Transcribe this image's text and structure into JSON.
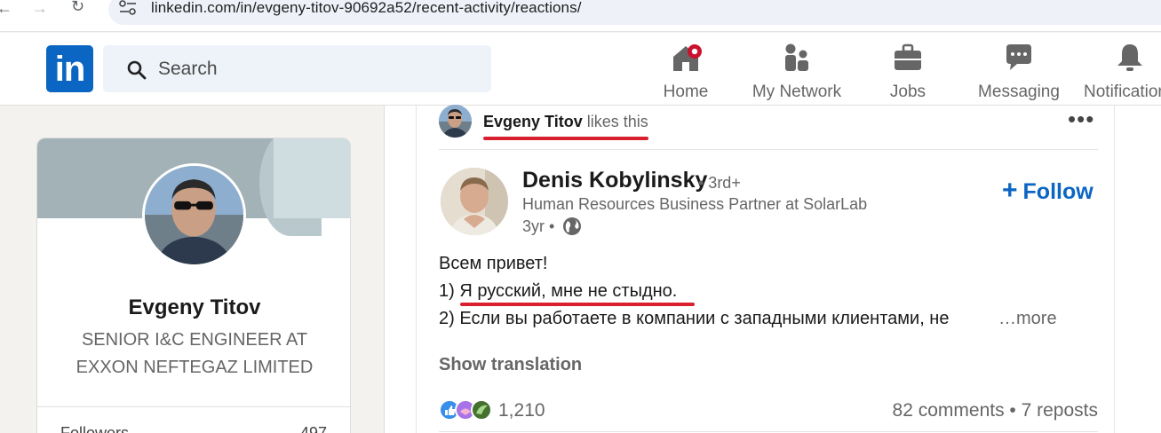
{
  "browser": {
    "url": "linkedin.com/in/evgeny-titov-90692a52/recent-activity/reactions/"
  },
  "header": {
    "logo_text": "in",
    "search": {
      "placeholder": "Search"
    },
    "nav": [
      {
        "label": "Home",
        "icon": "home-icon"
      },
      {
        "label": "My Network",
        "icon": "network-icon"
      },
      {
        "label": "Jobs",
        "icon": "briefcase-icon"
      },
      {
        "label": "Messaging",
        "icon": "message-icon"
      },
      {
        "label": "Notifications",
        "icon": "bell-icon"
      }
    ],
    "accent_color": "#0a66c2",
    "notification_dot_color": "#cb112d"
  },
  "profile": {
    "name": "Evgeny Titov",
    "headline": "SENIOR I&C ENGINEER AT EXXON NEFTEGAZ LIMITED",
    "followers_label": "Followers",
    "followers_count": "497"
  },
  "activity": {
    "actor": "Evgeny Titov",
    "action": "likes this",
    "more_icon": "more-dots-icon"
  },
  "post": {
    "author": "Denis Kobylinsky",
    "degree": "• 3rd+",
    "headline": "Human Resources Business Partner at SolarLab",
    "time": "3yr •",
    "follow_label": "Follow",
    "lines": [
      "Всем привет!",
      "1) Я русский, мне не стыдно.",
      "2) Если вы работаете в компании с западными клиентами, не"
    ],
    "see_more": "…more",
    "show_translation": "Show translation",
    "reaction_count": "1,210",
    "comments_reposts": "82 comments • 7 reposts",
    "highlight_color": "#d9202f"
  }
}
